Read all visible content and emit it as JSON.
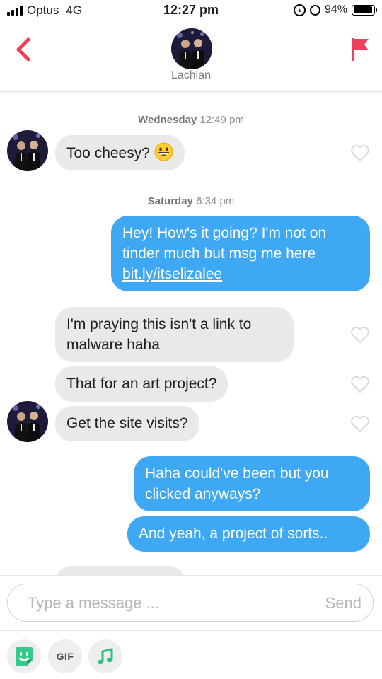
{
  "status_bar": {
    "carrier": "Optus",
    "network": "4G",
    "time": "12:27 pm",
    "battery": "94%",
    "battery_level": 0.94,
    "icons": [
      "signal-icon",
      "rotation-lock-icon",
      "alarm-icon",
      "battery-icon"
    ]
  },
  "header": {
    "contact_name": "Lachlan",
    "back_icon": "chevron-left-icon",
    "report_icon": "flag-icon",
    "accent_color": "#f03e5b"
  },
  "chat": {
    "timestamp_1": {
      "day": "Wednesday",
      "time": "12:49 pm"
    },
    "msg_1": {
      "text": "Too cheesy?",
      "emoji": "grinning-face-emoji"
    },
    "timestamp_2": {
      "day": "Saturday",
      "time": "6:34 pm"
    },
    "msg_2": {
      "line1": "Hey! How's it going? I'm not on",
      "line2": "tinder much but msg me here",
      "link": "bit.ly/itselizalee"
    },
    "msg_3": {
      "line1": "I'm praying this isn't a link to",
      "line2": "malware haha"
    },
    "msg_4": {
      "text": "That for an art project?"
    },
    "msg_5": {
      "text": "Get the site visits?"
    },
    "msg_6": {
      "line1": "Haha could've been but you",
      "line2": "clicked anyways?"
    },
    "msg_7": {
      "text": "And yeah, a project of sorts.."
    }
  },
  "composer": {
    "placeholder": "Type a message ...",
    "send_label": "Send"
  },
  "toolbar": {
    "sticker_icon": "sticker-smile-icon",
    "gif_label": "GIF",
    "music_icon": "music-note-icon"
  },
  "colors": {
    "incoming_bubble": "#e9e9eb",
    "outgoing_bubble": "#3fa8f4",
    "sticker_green": "#35c98a",
    "music_green": "#2ec27e"
  }
}
